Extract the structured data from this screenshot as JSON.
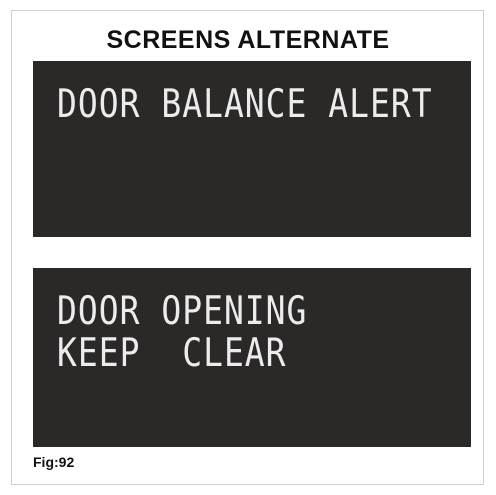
{
  "heading": "SCREENS ALTERNATE",
  "screens": [
    {
      "lines": [
        "DOOR BALANCE ALERT"
      ]
    },
    {
      "lines": [
        "DOOR OPENING",
        "KEEP  CLEAR"
      ]
    }
  ],
  "caption": "Fig:92",
  "colors": {
    "screen_background": "#2b2828",
    "screen_text": "#ececec",
    "border": "#cfcfcf"
  }
}
